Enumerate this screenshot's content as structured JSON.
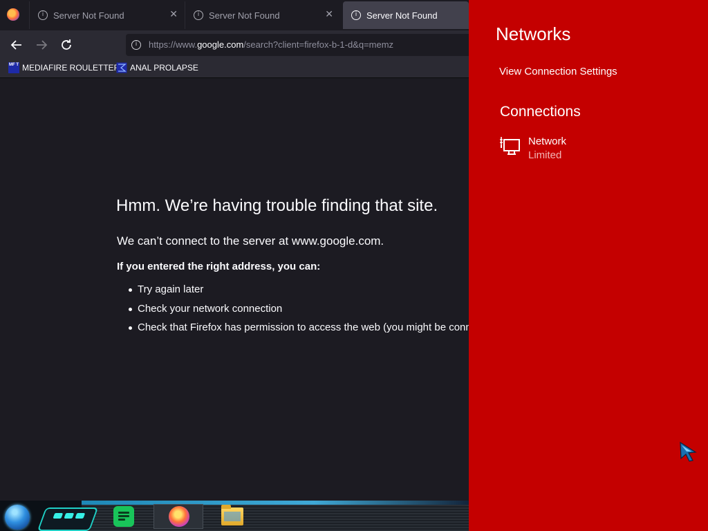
{
  "browser": {
    "tabs": [
      {
        "title": "Server Not Found",
        "active": false
      },
      {
        "title": "Server Not Found",
        "active": false
      },
      {
        "title": "Server Not Found",
        "active": true
      }
    ],
    "url": {
      "prefix": "https://www.",
      "domain": "google.com",
      "rest": "/search?client=firefox-b-1-d&q=memz"
    },
    "bookmarks": [
      {
        "label": "MEDIAFIRE ROULETTER",
        "icon": "mediafire-icon",
        "icon_text": "MF T"
      },
      {
        "label": "ANAL PROLAPSE",
        "icon": "sigma-icon"
      }
    ]
  },
  "error_page": {
    "title": "Hmm. We’re having trouble finding that site.",
    "description": "We can’t connect to the server at www.google.com.",
    "subtitle": "If you entered the right address, you can:",
    "suggestions": [
      "Try again later",
      "Check your network connection",
      "Check that Firefox has permission to access the web (you might be connected but behind a firewall)"
    ]
  },
  "taskbar": {
    "apps": [
      "start-orb",
      "hud-widget",
      "notes-app",
      "firefox",
      "file-explorer"
    ]
  },
  "networks_flyout": {
    "title": "Networks",
    "settings_link": "View Connection Settings",
    "section_title": "Connections",
    "connections": [
      {
        "name": "Network",
        "status": "Limited",
        "icon": "wired-network-icon"
      }
    ],
    "background_color": "#c40000"
  },
  "colors": {
    "browser_bg": "#1c1b22",
    "toolbar": "#2b2a33",
    "text": "#fbfbfe"
  }
}
